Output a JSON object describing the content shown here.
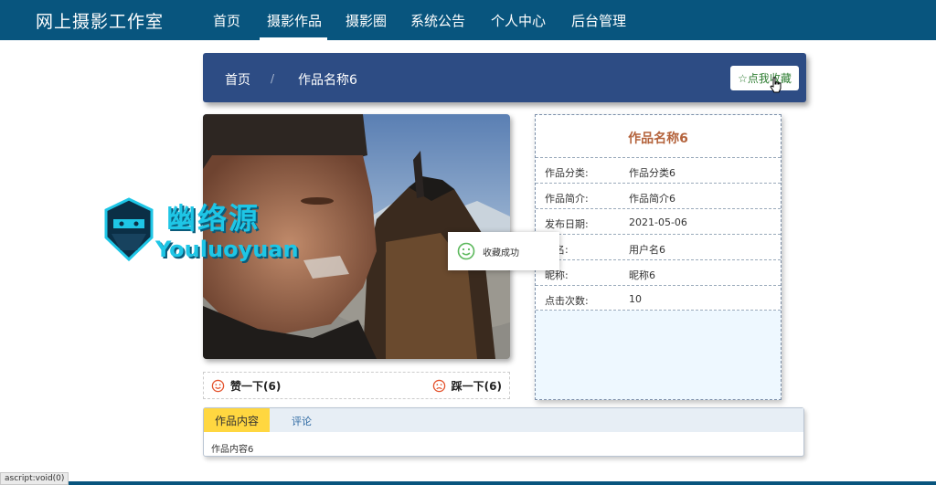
{
  "nav": {
    "brand": "网上摄影工作室",
    "items": [
      "首页",
      "摄影作品",
      "摄影圈",
      "系统公告",
      "个人中心",
      "后台管理"
    ],
    "active_index": 1
  },
  "breadcrumb": {
    "home": "首页",
    "separator": "/",
    "current": "作品名称6",
    "favorite_label": "☆点我收藏"
  },
  "detail": {
    "title": "作品名称6",
    "rows": [
      {
        "key": "作品分类:",
        "value": "作品分类6"
      },
      {
        "key": "作品简介:",
        "value": "作品简介6"
      },
      {
        "key": "发布日期:",
        "value": "2021-05-06"
      },
      {
        "key": "户名:",
        "value": "用户名6"
      },
      {
        "key": "昵称:",
        "value": "昵称6"
      },
      {
        "key": "点击次数:",
        "value": "10"
      }
    ]
  },
  "votes": {
    "like": "赞一下(6)",
    "dislike": "踩一下(6)"
  },
  "toast": {
    "message": "收藏成功"
  },
  "tabs": {
    "active": "作品内容",
    "comment": "评论",
    "content": "作品内容6"
  },
  "watermark": {
    "cn": "幽络源",
    "en": "Youluoyuan"
  },
  "status_bar": "ascript:void(0)",
  "colors": {
    "nav_bg": "#08557e",
    "crumb_bg": "#2d4c84",
    "title_accent": "#b4633c",
    "tab_active": "#ffd740",
    "watermark": "#1ec6e6"
  },
  "icons": {
    "favorite": "star-outline-icon",
    "like": "smile-icon",
    "dislike": "frown-icon",
    "toast": "smile-icon"
  }
}
